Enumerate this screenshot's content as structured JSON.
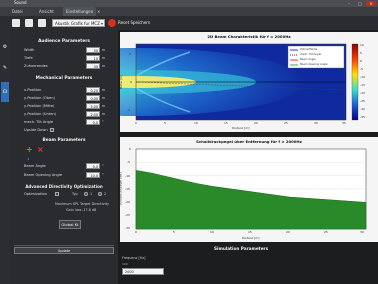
{
  "window": {
    "title": "Sound"
  },
  "menu": {
    "items": [
      "Datei",
      "Ansicht",
      "Einstellungen"
    ],
    "active_index": 2
  },
  "toolbar": {
    "combo_value": "Akustik Grafik fur MCZ Beam",
    "reset_label": "Reset Speichern"
  },
  "rail": {
    "items": [
      {
        "icon": "gear-icon",
        "glyph": "⚙"
      },
      {
        "icon": "sound-icon",
        "glyph": "✎"
      },
      {
        "icon": "chart-icon",
        "glyph": "☊"
      }
    ]
  },
  "audience": {
    "title": "Audience Parameters",
    "rows": [
      {
        "label": "Width",
        "value": "50",
        "unit": "m"
      },
      {
        "label": "Tiefe",
        "value": "10",
        "unit": "m"
      },
      {
        "label": "Zuhoerendes",
        "value": "30",
        "unit": "m"
      }
    ]
  },
  "mechanical": {
    "title": "Mechanical Parameters",
    "rows": [
      {
        "label": "x-Position",
        "value": "0.20",
        "unit": "m"
      },
      {
        "label": "y-Position (Oben)",
        "value": "0.00",
        "unit": "m"
      },
      {
        "label": "y-Position (Mitte)",
        "value": "5.00",
        "unit": "m"
      },
      {
        "label": "y-Position (Unten)",
        "value": "2.00",
        "unit": "m"
      },
      {
        "label": "mech. Tilt Angle",
        "value": "0.0",
        "unit": "°"
      }
    ],
    "upside_down_label": "Upside Down"
  },
  "beam": {
    "title": "Beam Parameters",
    "count": "1",
    "rows": [
      {
        "label": "Beam Angle",
        "value": "0.0",
        "unit": "°"
      },
      {
        "label": "Beam Opening Angle",
        "value": "10.0",
        "unit": "°"
      }
    ]
  },
  "optimization": {
    "title": "Advanced Directivity Optimization",
    "optimization_label": "Optimization",
    "type_label": "Typ",
    "type_value_a": "1",
    "type_value_b": "2",
    "max_spl_label": "Maximum SPL",
    "target_dir_label": "Target Directivity",
    "gain_label": "Gain loss",
    "gain_value": "-17.8 dB",
    "global_button": "Global Kt"
  },
  "bottom_tab": {
    "label": "Update"
  },
  "plot_top": {
    "title": "2D Beam Charakteristik für f = 2000Hz",
    "x_label": "Distanz [m]",
    "y_label": "Höhe [m]",
    "x_ticks": [
      "0",
      "5",
      "10",
      "15",
      "20",
      "25",
      "30",
      "35"
    ],
    "y_ticks": [
      "5",
      "0",
      "-5"
    ],
    "colorbar_ticks": [
      "10",
      "5",
      "0",
      "-5",
      "-10",
      "-15",
      "-20",
      "-25",
      "-30",
      "-35"
    ],
    "legend": [
      "Zuhoerfläche",
      "mech. Tilt Angle",
      "Beam Angle",
      "Beam Opening Angle"
    ]
  },
  "plot_bottom": {
    "title": "Schalldruckpegel über Entfernung für f = 2000Hz",
    "x_label": "Distanz [m]",
    "y_label": "Schalldruckpegel [dB]",
    "x_ticks": [
      "0",
      "5",
      "10",
      "15",
      "20",
      "25",
      "30"
    ],
    "y_ticks": [
      "0",
      "-5",
      "-10",
      "-15",
      "-20",
      "-25",
      "-30"
    ]
  },
  "simulation": {
    "title": "Simulation Parameters",
    "freq_label": "Frequenz [Hz]",
    "freq_small": "100",
    "freq_value": "2000"
  },
  "colors": {
    "beam_accent": "#2f6db5",
    "area_fill": "#2a8a2a",
    "add": "#3cbc3c",
    "remove": "#e03a3a"
  },
  "chart_data": [
    {
      "type": "heatmap",
      "title": "2D Beam Charakteristik für f = 2000Hz",
      "xlabel": "Distanz [m]",
      "ylabel": "Höhe [m]",
      "xlim": [
        0,
        35
      ],
      "ylim": [
        -5,
        5
      ],
      "colorbar": [
        -35,
        10
      ]
    },
    {
      "type": "area",
      "title": "Schalldruckpegel über Entfernung für f = 2000Hz",
      "xlabel": "Distanz [m]",
      "ylabel": "Schalldruckpegel [dB]",
      "x": [
        0,
        2,
        5,
        8,
        10,
        15,
        20,
        25,
        30
      ],
      "y": [
        -8,
        -9,
        -11,
        -13,
        -14,
        -16,
        -18,
        -19,
        -20
      ],
      "xlim": [
        0,
        30
      ],
      "ylim": [
        -30,
        0
      ]
    }
  ]
}
